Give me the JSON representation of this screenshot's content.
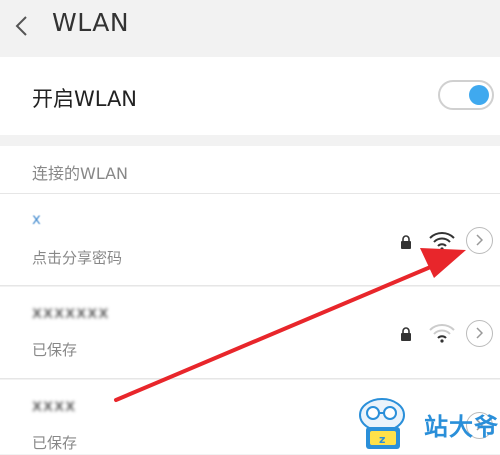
{
  "header": {
    "title": "WLAN",
    "back_icon": "chevron-left-icon"
  },
  "wlan_toggle": {
    "label": "开启WLAN",
    "enabled": true,
    "accent": "#3fa9ef"
  },
  "connected_section": {
    "title": "连接的WLAN"
  },
  "networks": [
    {
      "name": "x",
      "status": "点击分享密码",
      "locked": true,
      "signal": "strong"
    },
    {
      "name": "xxxxxxx",
      "status": "已保存",
      "locked": true,
      "signal": "weak"
    },
    {
      "name": "xxxx",
      "status": "已保存",
      "locked": true,
      "signal": "weak"
    }
  ],
  "watermark": {
    "text": "站大爷"
  },
  "colors": {
    "page_bg": "#f2f2f2",
    "card_bg": "#ffffff",
    "arrow": "#e8262b"
  }
}
